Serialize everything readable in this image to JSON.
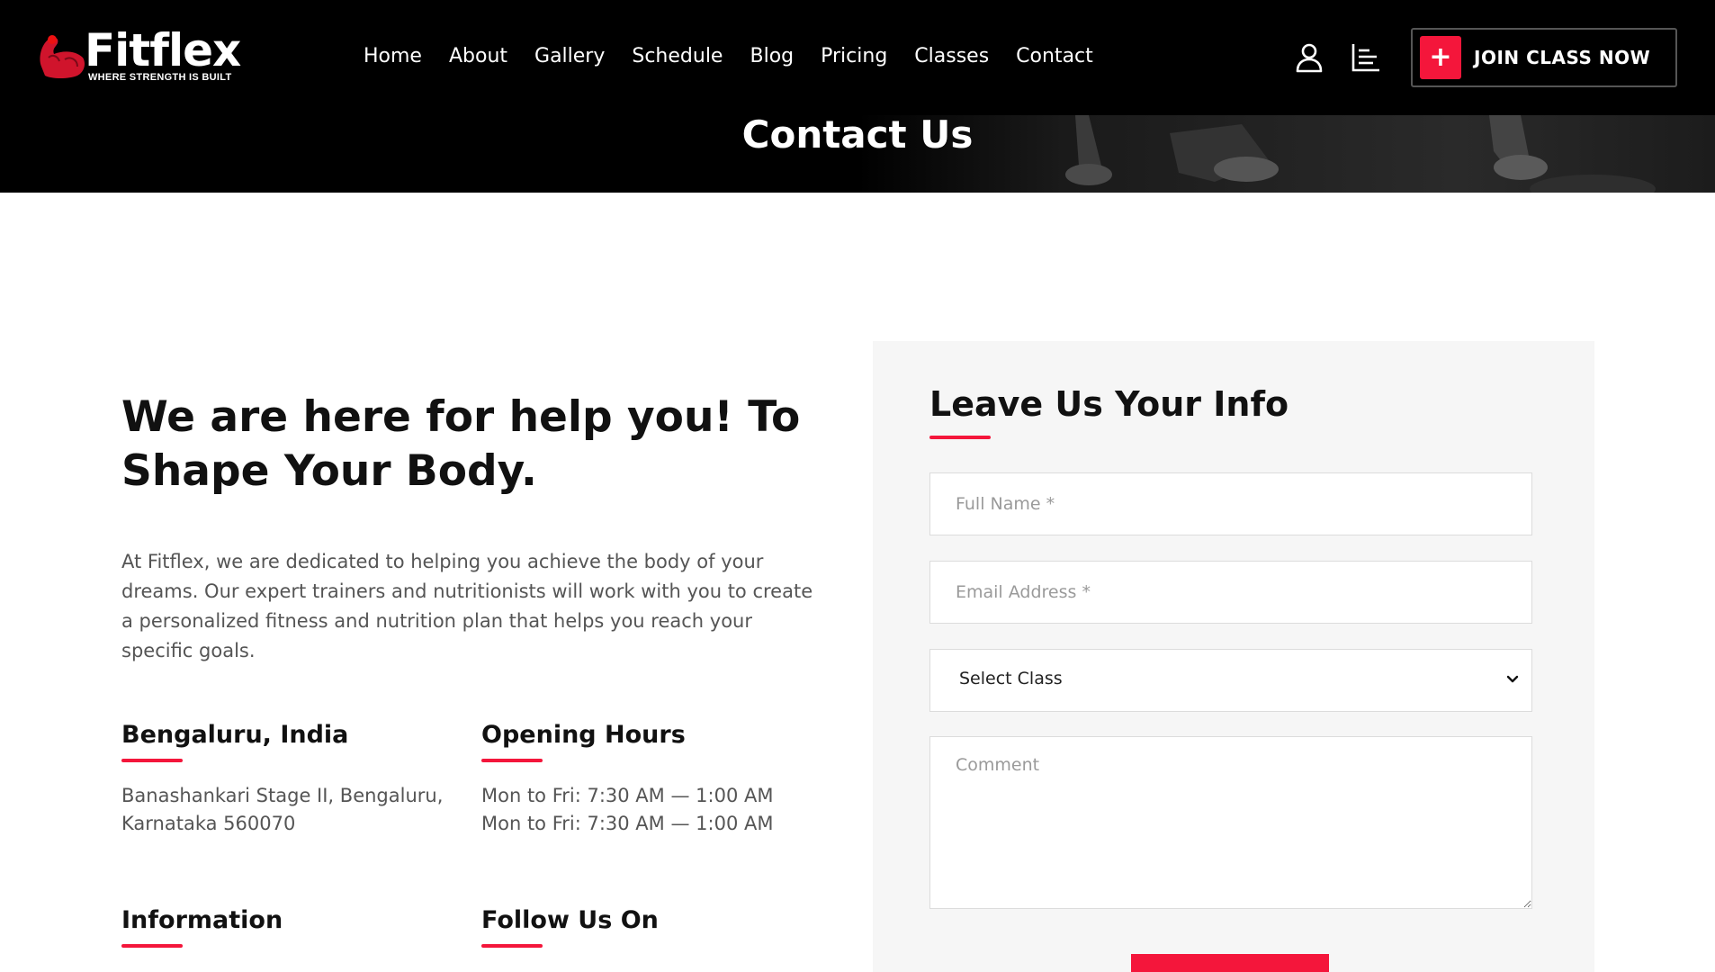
{
  "brand": {
    "name": "Fitflex",
    "tagline": "WHERE STRENGTH IS BUILT",
    "logo_icon": "flexed-arm-icon"
  },
  "nav": {
    "items": [
      {
        "label": "Home"
      },
      {
        "label": "About"
      },
      {
        "label": "Gallery"
      },
      {
        "label": "Schedule"
      },
      {
        "label": "Blog"
      },
      {
        "label": "Pricing"
      },
      {
        "label": "Classes"
      },
      {
        "label": "Contact"
      }
    ],
    "user_icon": "user-icon",
    "menu_icon": "list-icon",
    "join_button": {
      "label": "JOIN CLASS NOW",
      "icon": "plus-icon"
    }
  },
  "hero": {
    "title": "Contact Us"
  },
  "intro": {
    "heading": "We are here for help you! To Shape Your Body.",
    "text": "At Fitflex, we are dedicated to helping you achieve the body of your dreams. Our expert trainers and nutritionists will work with you to create a personalized fitness and nutrition plan that helps you reach your specific goals."
  },
  "location": {
    "title": "Bengaluru, India",
    "address_line1": "Banashankari Stage II, Bengaluru,",
    "address_line2": "Karnataka 560070"
  },
  "hours": {
    "title": "Opening Hours",
    "line1": "Mon to Fri: 7:30 AM — 1:00 AM",
    "line2": "Mon to Fri: 7:30 AM — 1:00 AM"
  },
  "information": {
    "title": "Information"
  },
  "follow": {
    "title": "Follow Us On"
  },
  "form": {
    "title": "Leave Us Your Info",
    "full_name_placeholder": "Full Name *",
    "email_placeholder": "Email Address *",
    "class_select_value": "Select Class",
    "comment_placeholder": "Comment"
  },
  "colors": {
    "accent": "#f4163b",
    "header_bg": "#000000",
    "panel_bg": "#f6f6f6"
  }
}
